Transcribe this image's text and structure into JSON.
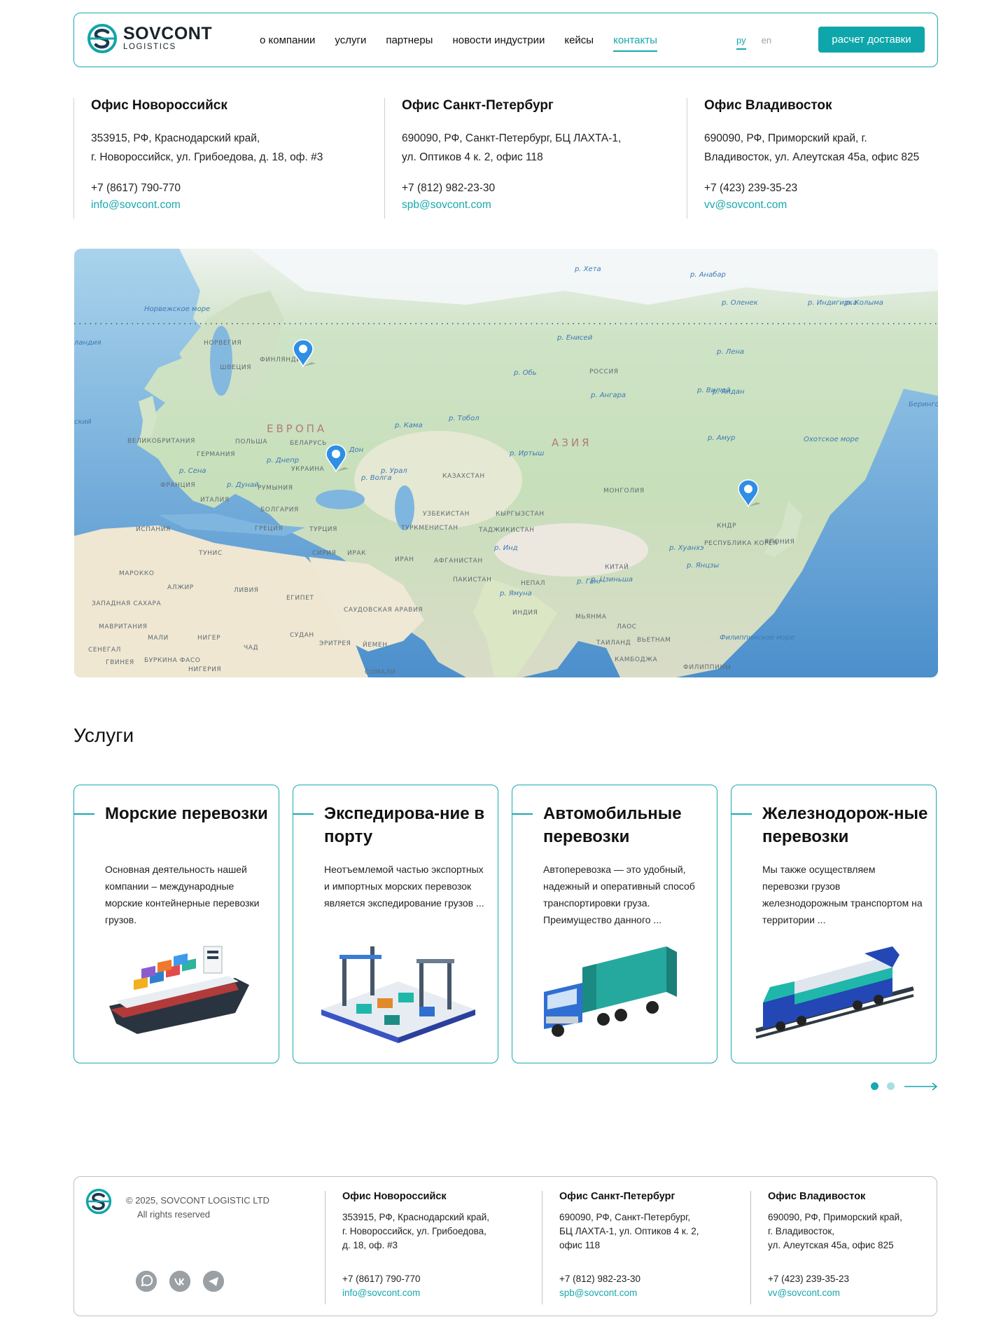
{
  "header": {
    "brand_line1": "SOVCONT",
    "brand_line2": "LOGISTICS",
    "nav": [
      "о компании",
      "услуги",
      "партнеры",
      "новости индустрии",
      "кейсы",
      "контакты"
    ],
    "active_nav": "контакты",
    "lang_ru": "ру",
    "lang_en": "en",
    "cta": "расчет доставки"
  },
  "offices": [
    {
      "title": "Офис Новороссийск",
      "addr1": "353915, РФ, Краснодарский край,",
      "addr2": "г. Новороссийск, ул. Грибоедова, д. 18, оф. #3",
      "phone": "+7 (8617) 790-770",
      "email": "info@sovcont.com"
    },
    {
      "title": "Офис Санкт-Петербург",
      "addr1": "690090, РФ, Санкт-Петербург, БЦ ЛАХТА-1,",
      "addr2": "ул. Оптиков 4 к. 2, офис 118",
      "phone": "+7 (812) 982-23-30",
      "email": "spb@sovcont.com"
    },
    {
      "title": "Офис Владивосток",
      "addr1": "690090, РФ, Приморский край, г.",
      "addr2": "Владивосток, ул. Алеутская 45а, офис 825",
      "phone": "+7 (423) 239-35-23",
      "email": "vv@sovcont.com"
    }
  ],
  "map": {
    "region_europe": "ЕВРОПА",
    "region_asia": "АЗИЯ",
    "countries": [
      "НОРВЕГИЯ",
      "ШВЕЦИЯ",
      "ФИНЛЯНДИЯ",
      "РОССИЯ",
      "ВЕЛИКОБРИТАНИЯ",
      "ГЕРМАНИЯ",
      "ПОЛЬША",
      "БЕЛАРУСЬ",
      "УКРАИНА",
      "ФРАНЦИЯ",
      "РУМЫНИЯ",
      "ИТАЛИЯ",
      "БОЛГАРИЯ",
      "ИСПАНИЯ",
      "ГРЕЦИЯ",
      "ТУРЦИЯ",
      "ТУНИС",
      "СИРИЯ",
      "ИРАК",
      "ИРАН",
      "МАРОККО",
      "АЛЖИР",
      "ЛИВИЯ",
      "ЕГИПЕТ",
      "ЗАПАДНАЯ САХАРА",
      "МАВРИТАНИЯ",
      "МАЛИ",
      "НИГЕР",
      "ЧАД",
      "СУДАН",
      "ЭРИТРЕЯ",
      "ЙЕМЕН",
      "СЕНЕГАЛ",
      "ГВИНЕЯ",
      "БУРКИНА ФАСО",
      "НИГЕРИЯ",
      "СОМАЛИ",
      "САУДОВСКАЯ АРАВИЯ",
      "КАЗАХСТАН",
      "УЗБЕКИСТАН",
      "ТУРКМЕНИСТАН",
      "КЫРГЫЗСТАН",
      "ТАДЖИКИСТАН",
      "АФГАНИСТАН",
      "ПАКИСТАН",
      "ИНДИЯ",
      "НЕПАЛ",
      "МОНГОЛИЯ",
      "КИТАЙ",
      "КНДР",
      "РЕСПУБЛИКА КОРЕЯ",
      "ЯПОНИЯ",
      "МЬЯНМА",
      "ЛАОС",
      "ТАИЛАНД",
      "ВЬЕТНАМ",
      "КАМБОДЖА",
      "ФИЛИППИНЫ"
    ],
    "seas": [
      "Норвежское море",
      "Охотское море",
      "Берингово море",
      "Филиппинское море",
      "ландия",
      "ский"
    ],
    "rivers": [
      "р. Хета",
      "р. Анабар",
      "р. Оленек",
      "р. Индигирка",
      "р. Колыма",
      "р. Лена",
      "р. Вилюй",
      "р. Алдан",
      "р. Ангара",
      "р. Амур",
      "р. Обь",
      "р. Енисей",
      "р. Кама",
      "р. Тобол",
      "р. Иртыш",
      "р. Урал",
      "р. Дон",
      "р. Волга",
      "р. Днепр",
      "р. Дунай",
      "р. Сена",
      "р. Инд",
      "р. Ганг",
      "р. Янцзы",
      "р. Хуанхэ",
      "р. Ямуна",
      "р. Цзиньша"
    ],
    "pins": [
      "Санкт-Петербург",
      "Новороссийск",
      "Владивосток"
    ]
  },
  "services": {
    "title": "Услуги",
    "cards": [
      {
        "title": "Морские перевозки",
        "text": "Основная деятельность нашей компании – международные морские контейнерные перевозки грузов.",
        "icon": "ship-icon"
      },
      {
        "title": "Экспедирова-ние в порту",
        "text": "Неотъемлемой частью экспортных и импортных морских перевозок является экспедирование грузов ...",
        "icon": "port-icon"
      },
      {
        "title": "Автомобильные перевозки",
        "text": "Автоперевозка — это удобный, надежный и оперативный способ транспортировки груза. Преимущество данного ...",
        "icon": "truck-icon"
      },
      {
        "title": "Железнодорож-ные перевозки",
        "text": "Мы также осуществляем перевозки грузов железнодорожным транспортом на территории ...",
        "icon": "train-icon"
      }
    ],
    "pagination": {
      "current": 1,
      "total": 2
    }
  },
  "footer": {
    "copyright": "© 2025, SOVCONT LOGISTIC LTD",
    "rights": "All rights reserved",
    "social": [
      "whatsapp-icon",
      "vk-icon",
      "telegram-icon"
    ],
    "offices": [
      {
        "title": "Офис Новороссийск",
        "addr": [
          "353915, РФ, Краснодарский край,",
          "г. Новороссийск, ул. Грибоедова,",
          "д. 18, оф. #3"
        ],
        "phone": "+7 (8617) 790-770",
        "email": "info@sovcont.com"
      },
      {
        "title": "Офис Санкт-Петербург",
        "addr": [
          "690090, РФ, Санкт-Петербург,",
          "БЦ ЛАХТА-1, ул. Оптиков 4 к. 2,",
          "офис 118"
        ],
        "phone": "+7 (812) 982-23-30",
        "email": "spb@sovcont.com"
      },
      {
        "title": "Офис Владивосток",
        "addr": [
          "690090, РФ, Приморский край,",
          "г. Владивосток,",
          "ул. Алеутская 45а, офис 825"
        ],
        "phone": "+7 (423) 239-35-23",
        "email": "vv@sovcont.com"
      }
    ]
  },
  "colors": {
    "accent": "#0ea6ab",
    "border": "#1aa9ae",
    "text": "#111111",
    "muted": "#9aa3a8"
  }
}
